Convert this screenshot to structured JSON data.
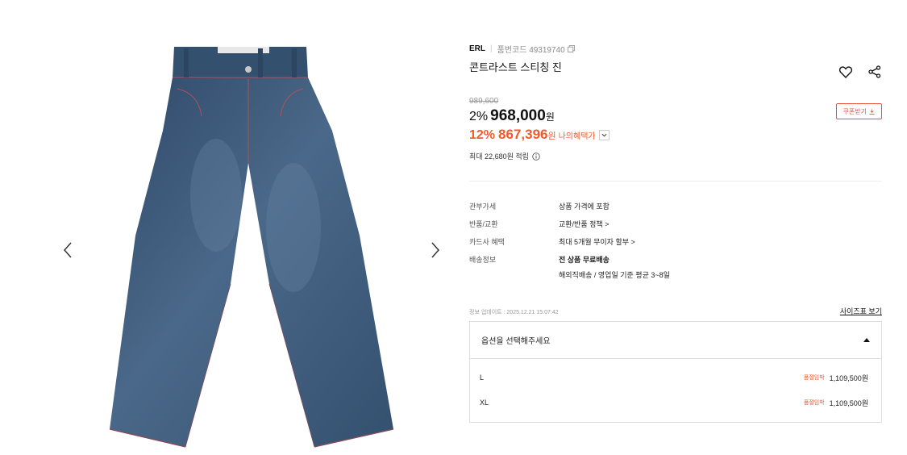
{
  "product": {
    "brand": "ERL",
    "code_label": "품번코드 49319740",
    "name": "콘트라스트 스티칭 진"
  },
  "price": {
    "original": "989,600",
    "sale_rate": "2%",
    "sale_price": "968,000",
    "currency": "원",
    "my_rate": "12%",
    "my_price": "867,396",
    "my_label": "나의혜택가",
    "coupon_label": "쿠폰받기",
    "points": "최대 22,680원 적립"
  },
  "specs": [
    {
      "label": "관부가세",
      "value": "상품 가격에 포함"
    },
    {
      "label": "반품/교환",
      "value": "교환/반품 정책 >"
    },
    {
      "label": "카드사 혜택",
      "value": "최대 5개월 무이자 할부 >"
    },
    {
      "label": "배송정보",
      "value": "전 상품 무료배송",
      "value2": "해외직배송 / 영업일 기준 평균 3~8일"
    }
  ],
  "updated": "정보 업데이트 : 2025.12.21 15:07:42",
  "size_link": "사이즈표 보기",
  "options": {
    "placeholder": "옵션을 선택해주세요",
    "items": [
      {
        "name": "L",
        "tag": "품절임박",
        "price": "1,109,500원"
      },
      {
        "name": "XL",
        "tag": "품절임박",
        "price": "1,109,500원"
      }
    ]
  },
  "icons": {
    "wishlist": "heart-icon",
    "share": "share-icon",
    "prev": "chevron-left-icon",
    "next": "chevron-right-icon"
  },
  "colors": {
    "accent": "#f15a2b",
    "coupon": "#e8553a",
    "denim": "#3b5677"
  }
}
